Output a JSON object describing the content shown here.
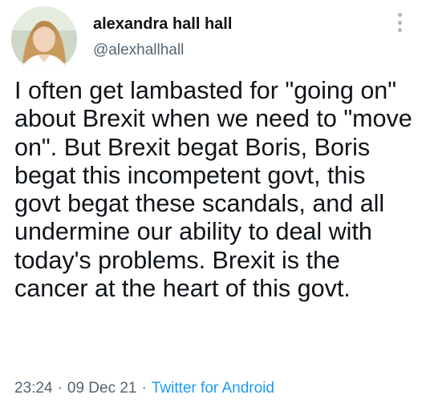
{
  "tweet": {
    "author_name": "alexandra hall hall",
    "handle": "@alexhallhall",
    "text": "I often get lambasted for \"going on\" about Brexit when we need to \"move on\".  But Brexit begat Boris, Boris begat this incompetent govt,  this govt begat these scandals, and all undermine our ability to deal with today's problems. Brexit is the cancer at the heart of this govt.",
    "time": "23:24",
    "date": "09 Dec 21",
    "separator": "·",
    "source": "Twitter for Android"
  },
  "icons": {
    "more": "more-vertical-icon",
    "avatar": "profile-photo"
  },
  "colors": {
    "text": "#0f1419",
    "secondary": "#536471",
    "link": "#1d9bf0",
    "background": "#ffffff"
  }
}
